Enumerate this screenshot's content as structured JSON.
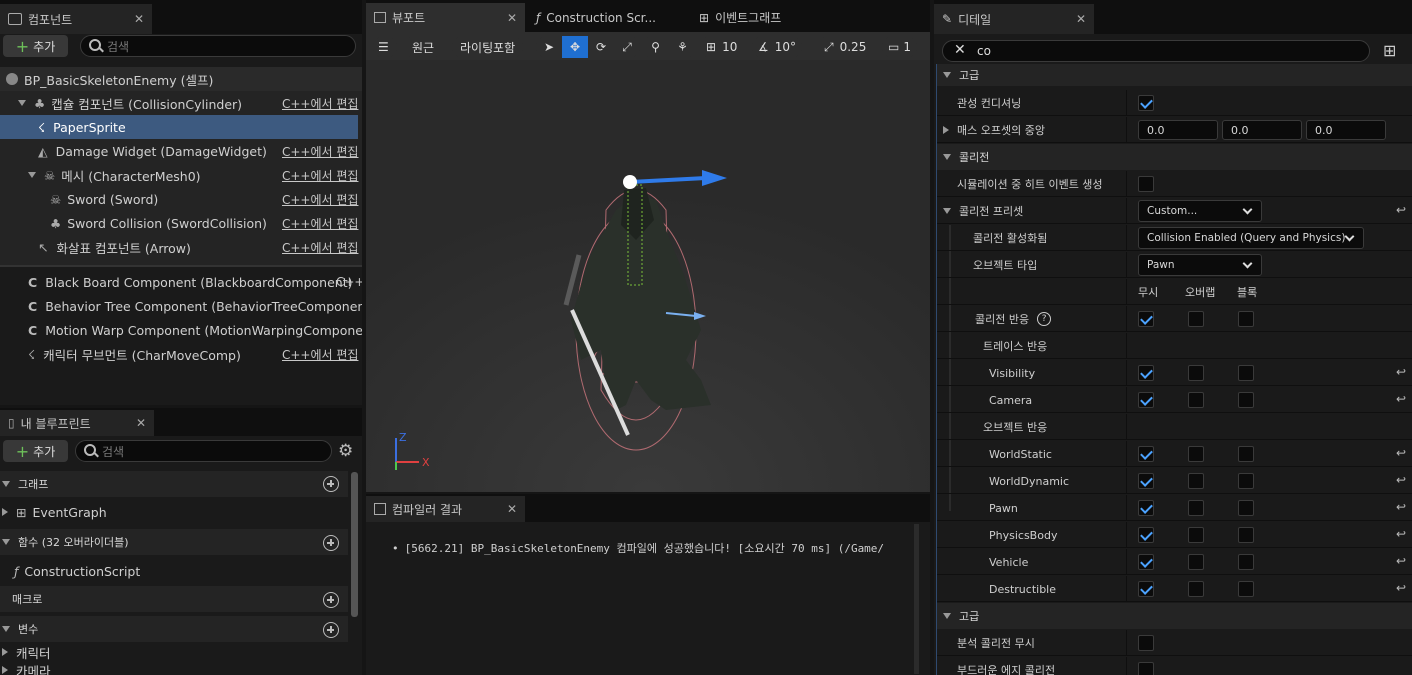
{
  "components": {
    "tab_title": "컴포넌트",
    "add_label": "추가",
    "search_placeholder": "검색",
    "root": "BP_BasicSkeletonEnemy (셀프)",
    "edit_cpp": "C++에서 편집",
    "edit_cpp_short": "C++",
    "items": [
      {
        "label": "캡슐 컴포넌트 (CollisionCylinder)"
      },
      {
        "label": "PaperSprite"
      },
      {
        "label": "Damage Widget (DamageWidget)"
      },
      {
        "label": "메시 (CharacterMesh0)"
      },
      {
        "label": "Sword (Sword)"
      },
      {
        "label": "Sword Collision (SwordCollision)"
      },
      {
        "label": "화살표 컴포넌트 (Arrow)"
      }
    ],
    "actor_items": [
      {
        "label": "Black Board Component (BlackboardComponent)"
      },
      {
        "label": "Behavior Tree Component (BehaviorTreeComponent)"
      },
      {
        "label": "Motion Warp Component (MotionWarpingComponent)"
      },
      {
        "label": "캐릭터 무브먼트 (CharMoveComp)"
      }
    ]
  },
  "blueprint": {
    "tab_title": "내 블루프린트",
    "add_label": "추가",
    "search_placeholder": "검색",
    "graph_header": "그래프",
    "event_graph": "EventGraph",
    "functions_header": "함수 (32 오버라이더블)",
    "construction_script": "ConstructionScript",
    "macros_header": "매크로",
    "variables_header": "변수",
    "var_character": "캐릭터",
    "var_camera": "카메라"
  },
  "viewport": {
    "tabs": [
      "뷰포트",
      "Construction Scr...",
      "이벤트그래프"
    ],
    "perspective": "원근",
    "lighting": "라이팅포함",
    "grid_value": "10",
    "angle_value": "10°",
    "scale_value": "0.25",
    "camera_value": "1",
    "axis_z": "Z",
    "axis_x": "X"
  },
  "compiler": {
    "tab_title": "컴파일러 결과",
    "message": "[5662.21] BP_BasicSkeletonEnemy 컴파일에 성공했습니다! [소요시간 70 ms] (/Game/"
  },
  "details": {
    "tab_title": "디테일",
    "search_value": "co",
    "advanced_top": "고급",
    "use_controller_rotation": "관성 컨디셔닝",
    "mass_offset": "매스 오프셋의 중앙",
    "mass_values": [
      "0.0",
      "0.0",
      "0.0"
    ],
    "collision_section": "콜리전",
    "sim_hit_events": "시뮬레이션 중 히트 이벤트 생성",
    "collision_presets": "콜리전 프리셋",
    "preset_value": "Custom...",
    "collision_enabled_label": "콜리전 활성화됨",
    "collision_enabled_value": "Collision Enabled (Query and Physics)",
    "object_type_label": "오브젝트 타입",
    "object_type_value": "Pawn",
    "col_ignore": "무시",
    "col_overlap": "오버랩",
    "col_block": "블록",
    "collision_responses": "콜리전 반응",
    "trace_responses": "트레이스 반응",
    "trace_rows": [
      "Visibility",
      "Camera"
    ],
    "object_responses": "오브젝트 반응",
    "object_rows": [
      "WorldStatic",
      "WorldDynamic",
      "Pawn",
      "PhysicsBody",
      "Vehicle",
      "Destructible"
    ],
    "advanced_bottom": "고급",
    "ignore_analytic": "분석 콜리전 무시",
    "smooth_edge": "부드러운 에지 콜리전"
  }
}
